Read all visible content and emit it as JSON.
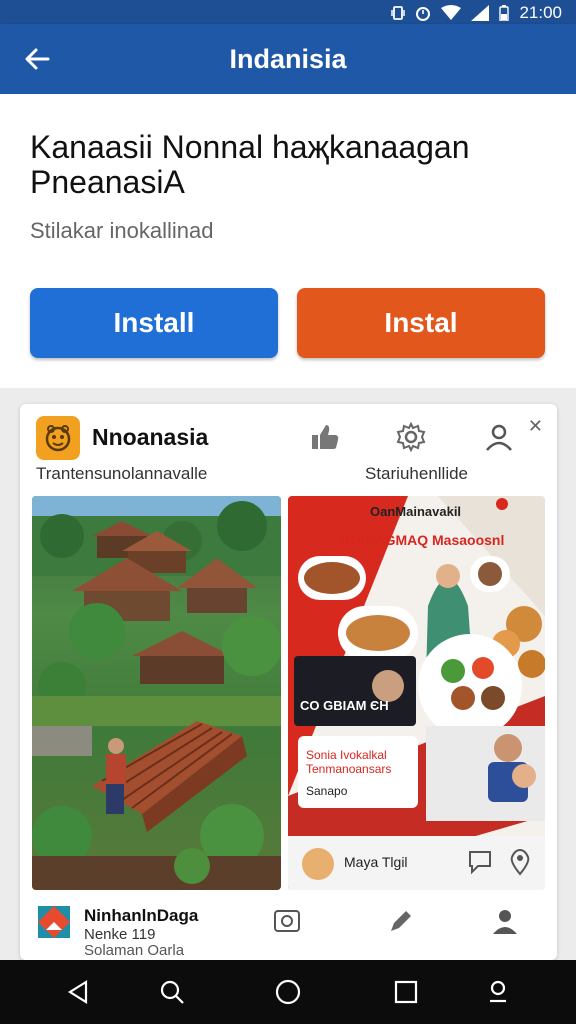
{
  "status_bar": {
    "time": "21:00"
  },
  "app_bar": {
    "title": "Indanisia"
  },
  "hero": {
    "headline": "Kanaasii Nonnal haҗkanaagan PneanasiA",
    "subline": "Stilakar inokallinad",
    "install_blue": "Install",
    "install_orange": "Instal"
  },
  "card": {
    "app_name": "Nnoanasia",
    "caption_left": "Trantensunolannavalle",
    "caption_right": "Stariuhenllide",
    "promo": {
      "top_title": "OanMainavakil",
      "banner": "ƎKAлAGMAQ Masaoosnl",
      "box1": "CO GBIAM ЄH",
      "box2_line1": "Sonia Ivokalkal",
      "box2_line2": "Tenmanoansars",
      "box2_tag": "Sanapo",
      "bottom_name": "Maya Tlgil"
    },
    "footer": {
      "name": "NinhanlnDaga",
      "sub1": "Nenke 119",
      "sub2": "Solaman Oarla"
    }
  },
  "colors": {
    "accent_blue": "#1f6fd6",
    "accent_orange": "#e2581c",
    "appbar": "#2058a8"
  }
}
